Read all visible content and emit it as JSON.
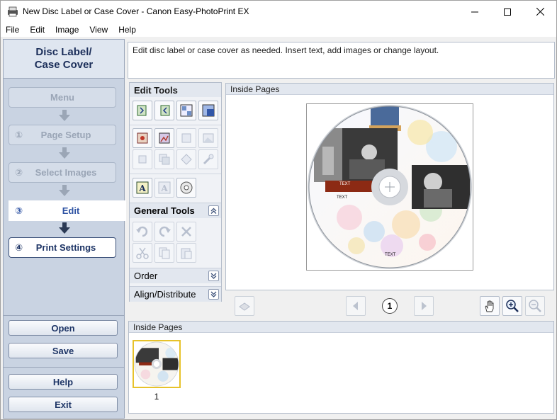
{
  "window": {
    "title": "New Disc Label or Case Cover - Canon Easy-PhotoPrint EX",
    "icons": [
      "app-icon",
      "minimize-icon",
      "maximize-icon",
      "close-icon"
    ]
  },
  "menu": [
    "File",
    "Edit",
    "Image",
    "View",
    "Help"
  ],
  "left_panel": {
    "title_line1": "Disc Label/",
    "title_line2": "Case Cover",
    "steps": [
      {
        "num": "",
        "label": "Menu"
      },
      {
        "num": "①",
        "label": "Page Setup"
      },
      {
        "num": "②",
        "label": "Select Images"
      },
      {
        "num": "③",
        "label": "Edit"
      },
      {
        "num": "④",
        "label": "Print Settings"
      }
    ],
    "buttons": {
      "open": "Open",
      "save": "Save",
      "help": "Help",
      "exit": "Exit"
    }
  },
  "instruction": "Edit disc label or case cover as needed. Insert text, add images or change layout.",
  "tools": {
    "edit_tools": "Edit Tools",
    "general_tools": "General Tools",
    "order": "Order",
    "align": "Align/Distribute"
  },
  "preview": {
    "header": "Inside Pages",
    "page": "1",
    "disc_texts": [
      "TEXT",
      "TEXT",
      "TEXT"
    ]
  },
  "thumbnails": {
    "header": "Inside Pages",
    "items": [
      {
        "label": "1"
      }
    ]
  },
  "colors": {
    "panel_bg": "#c9d3e2",
    "current_step": "#2e53a3",
    "thumb_selected": "#e7c22a"
  }
}
